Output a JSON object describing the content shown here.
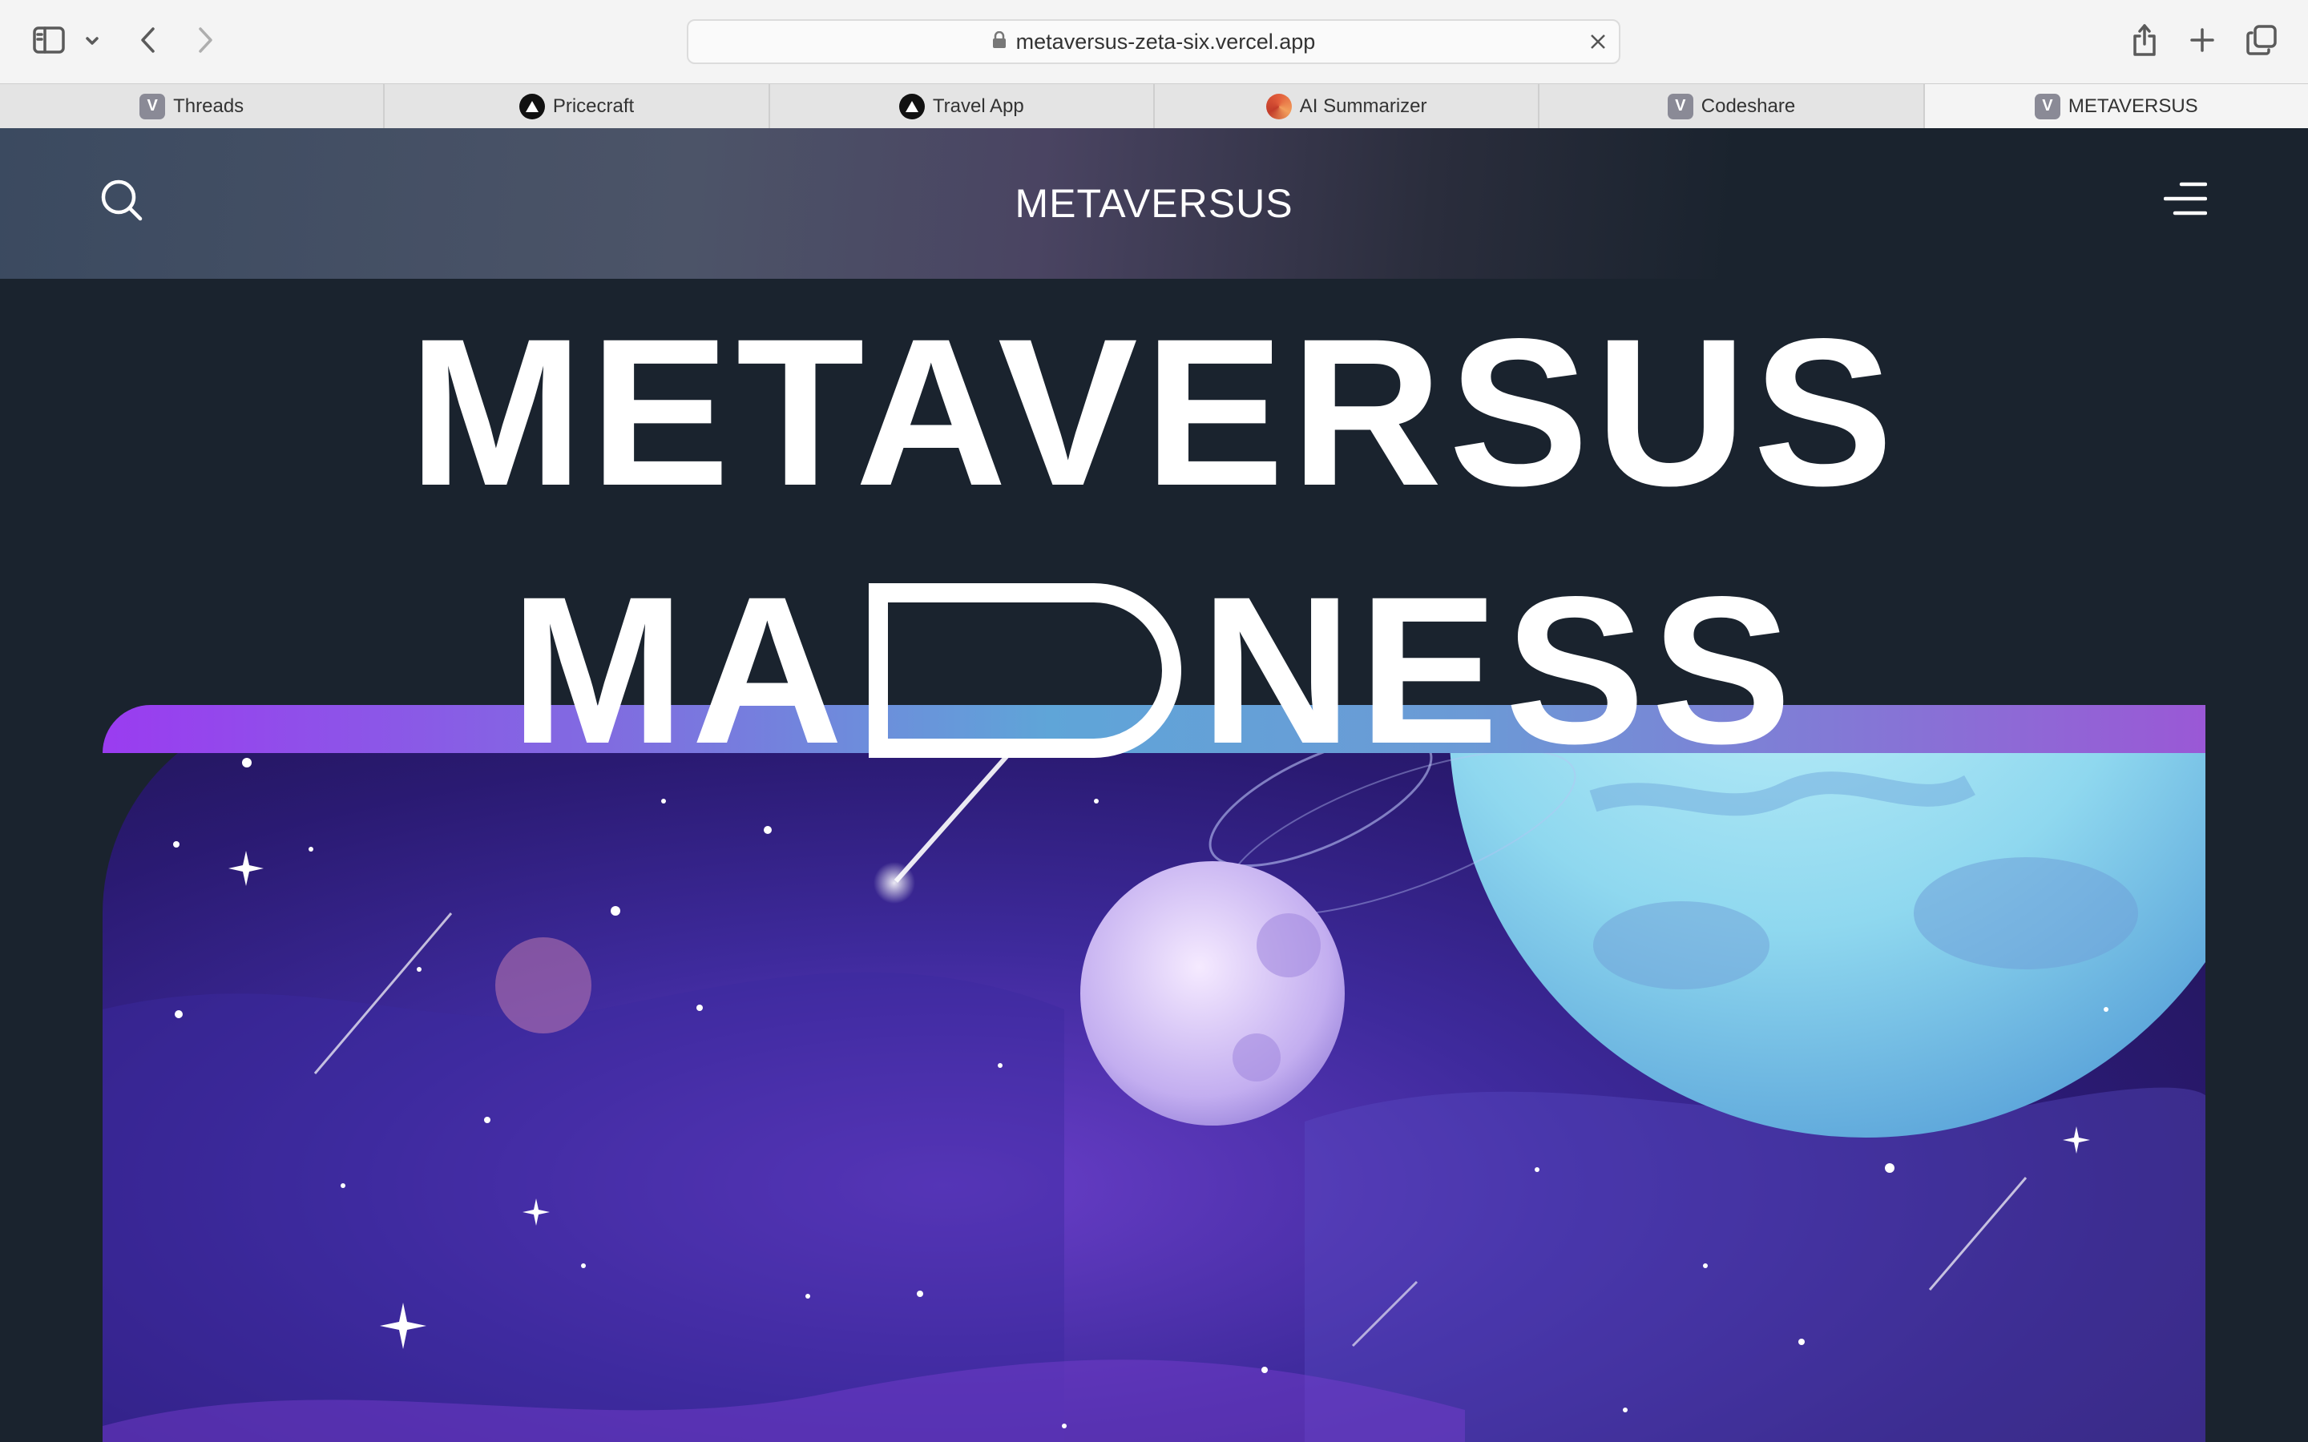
{
  "browser": {
    "url": "metaversus-zeta-six.vercel.app",
    "tabs": [
      {
        "label": "Threads",
        "icon": "v-favicon"
      },
      {
        "label": "Pricecraft",
        "icon": "triangle-favicon"
      },
      {
        "label": "Travel App",
        "icon": "triangle-favicon"
      },
      {
        "label": "AI Summarizer",
        "icon": "ai-favicon"
      },
      {
        "label": "Codeshare",
        "icon": "v-favicon"
      },
      {
        "label": "METAVERSUS",
        "icon": "v-favicon"
      }
    ],
    "favicon_letter": "V"
  },
  "site": {
    "nav_title": "METAVERSUS",
    "hero_line1": "METAVERSUS",
    "hero_line2_before": "MA",
    "hero_line2_after": "NESS"
  }
}
